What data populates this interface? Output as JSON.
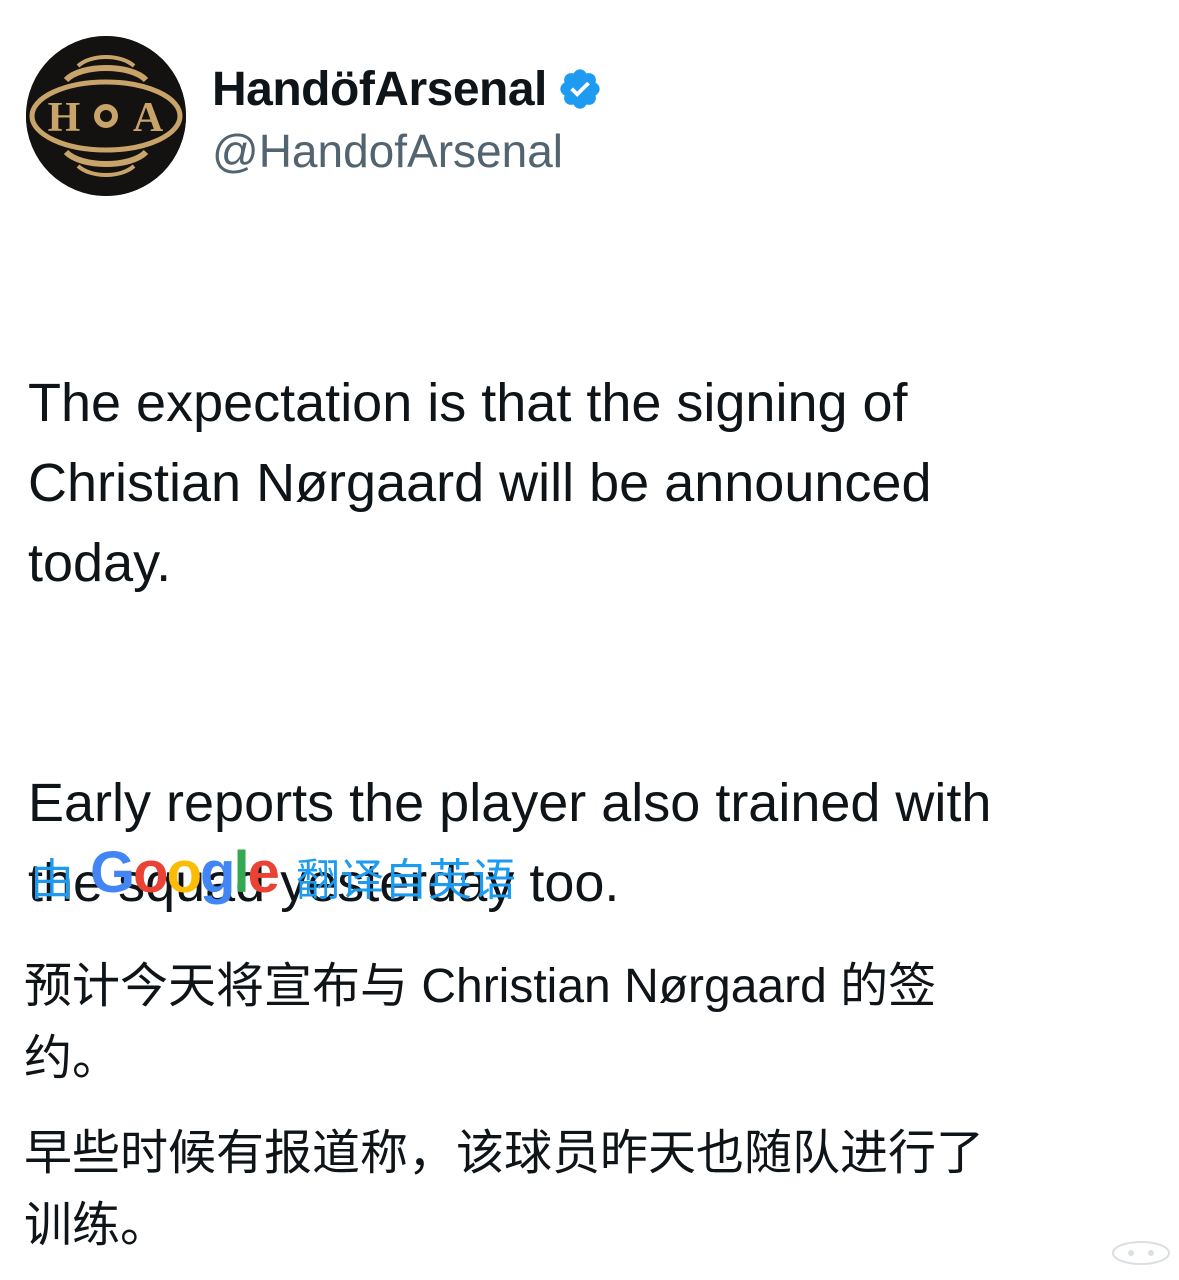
{
  "author": {
    "display_name": "HandöfArsenal",
    "handle": "@HandofArsenal",
    "avatar_monogram": [
      "H",
      "A"
    ],
    "verified_icon": "verified-badge-icon"
  },
  "tweet": {
    "paragraphs": [
      "The expectation is that the signing of\nChristian Nørgaard will be announced\ntoday.",
      "Early reports the player also trained with\nthe squad yesterday too."
    ]
  },
  "translation": {
    "prefix": "由",
    "provider": [
      "G",
      "o",
      "o",
      "g",
      "l",
      "e"
    ],
    "suffix": "翻译自英语",
    "paragraphs": [
      "预计今天将宣布与 Christian Nørgaard 的签\n约。",
      "早些时候有报道称，该球员昨天也随队进行了\n训练。"
    ]
  },
  "colors": {
    "link_blue": "#1d9bf0",
    "handle_gray": "#536471",
    "text": "#0f1419",
    "avatar_bg": "#141210",
    "avatar_gold": "#c8a46b",
    "google": [
      "#4285F4",
      "#EA4335",
      "#FBBC05",
      "#4285F4",
      "#34A853",
      "#EA4335"
    ]
  }
}
